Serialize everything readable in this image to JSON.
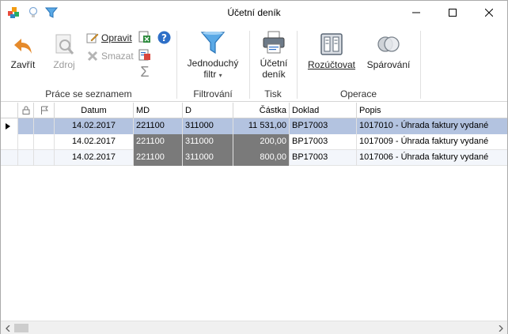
{
  "window": {
    "title": "Účetní deník",
    "quick_access": [
      "app-icon",
      "lightbulb-icon",
      "filter-icon"
    ]
  },
  "ribbon": {
    "close_label": "Zavřít",
    "source_label": "Zdroj",
    "edit_label": "Opravit",
    "delete_label": "Smazat",
    "sum_symbol": "Σ",
    "group_list": "Práce se seznamem",
    "simple_filter_line1": "Jednoduchý",
    "simple_filter_line2": "filtr",
    "group_filter": "Filtrování",
    "journal_line1": "Účetní",
    "journal_line2": "deník",
    "group_print": "Tisk",
    "allocate_label": "Rozúčtovat",
    "pair_label": "Spárování",
    "group_operations": "Operace"
  },
  "grid": {
    "columns": [
      "Datum",
      "MD",
      "D",
      "Částka",
      "Doklad",
      "Popis"
    ],
    "rows": [
      {
        "datum": "14.02.2017",
        "md": "221100",
        "d": "311000",
        "castka": "11 531,00",
        "doklad": "BP17003",
        "popis": "1017010 - Úhrada faktury vydané"
      },
      {
        "datum": "14.02.2017",
        "md": "221100",
        "d": "311000",
        "castka": "200,00",
        "doklad": "BP17003",
        "popis": "1017009 - Úhrada faktury vydané"
      },
      {
        "datum": "14.02.2017",
        "md": "221100",
        "d": "311000",
        "castka": "800,00",
        "doklad": "BP17003",
        "popis": "1017006 - Úhrada faktury vydané"
      }
    ]
  },
  "colors": {
    "accent": "#1e73be",
    "selected_row": "#b3c3e0",
    "dark_cell": "#7a7a7a",
    "close_orange": "#e58a2b"
  }
}
